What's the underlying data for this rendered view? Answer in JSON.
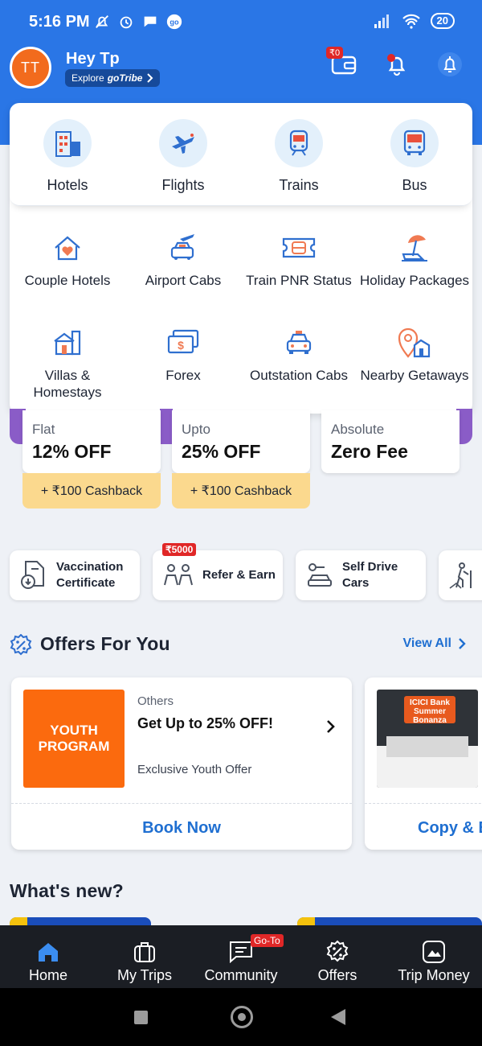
{
  "status_bar": {
    "time": "5:16 PM",
    "battery": "20"
  },
  "header": {
    "avatar_initials": "TT",
    "greeting": "Hey Tp",
    "explore_prefix": "Explore",
    "explore_brand": "goTribe",
    "wallet_balance": "₹0"
  },
  "primary_services": [
    {
      "label": "Hotels",
      "icon": "hotel-icon"
    },
    {
      "label": "Flights",
      "icon": "flight-icon"
    },
    {
      "label": "Trains",
      "icon": "train-icon"
    },
    {
      "label": "Bus",
      "icon": "bus-icon"
    }
  ],
  "secondary_services": [
    {
      "label": "Couple Hotels",
      "icon": "couple-hotels-icon"
    },
    {
      "label": "Airport Cabs",
      "icon": "airport-cab-icon"
    },
    {
      "label": "Train PNR Status",
      "icon": "pnr-ticket-icon"
    },
    {
      "label": "Holiday Packages",
      "icon": "beach-umbrella-icon"
    },
    {
      "label": "Villas & Homestays",
      "icon": "villa-icon"
    },
    {
      "label": "Forex",
      "icon": "forex-money-icon"
    },
    {
      "label": "Outstation Cabs",
      "icon": "outstation-cab-icon"
    },
    {
      "label": "Nearby Getaways",
      "icon": "location-pin-icon"
    }
  ],
  "deals": [
    {
      "top": "Flat",
      "main": "12% OFF",
      "cashback": "+ ₹100 Cashback"
    },
    {
      "top": "Upto",
      "main": "25% OFF",
      "cashback": "+ ₹100 Cashback"
    },
    {
      "top": "Absolute",
      "main": "Zero Fee"
    }
  ],
  "quick_chips": [
    {
      "label": "Vaccination Certificate",
      "icon": "document-download-icon"
    },
    {
      "label": "Refer & Earn",
      "icon": "people-icon",
      "badge": "₹5000"
    },
    {
      "label": "Self Drive Cars",
      "icon": "car-key-icon"
    },
    {
      "label": "",
      "icon": "hiker-icon"
    }
  ],
  "offers": {
    "title": "Offers For You",
    "view_all": "View All",
    "cards": [
      {
        "image_text": "YOUTH PROGRAM",
        "category": "Others",
        "title": "Get Up to 25% OFF!",
        "subtitle": "Exclusive Youth Offer",
        "cta": "Book Now"
      },
      {
        "image_text": "ICICI Bank Summer Bonanza",
        "cta": "Copy & E"
      }
    ]
  },
  "whats_new": "What's new?",
  "bottom_nav": [
    {
      "label": "Home",
      "icon": "home-icon",
      "active": true
    },
    {
      "label": "My Trips",
      "icon": "suitcase-icon"
    },
    {
      "label": "Community",
      "icon": "chat-icon",
      "badge": "Go-To"
    },
    {
      "label": "Offers",
      "icon": "offer-percent-icon"
    },
    {
      "label": "Trip Money",
      "icon": "trip-money-icon"
    }
  ],
  "colors": {
    "brand_blue": "#2a76e6",
    "accent_orange": "#f26b1d",
    "link_blue": "#1f6fd1",
    "cashback_yellow": "#fbd98e",
    "badge_red": "#e02727"
  }
}
